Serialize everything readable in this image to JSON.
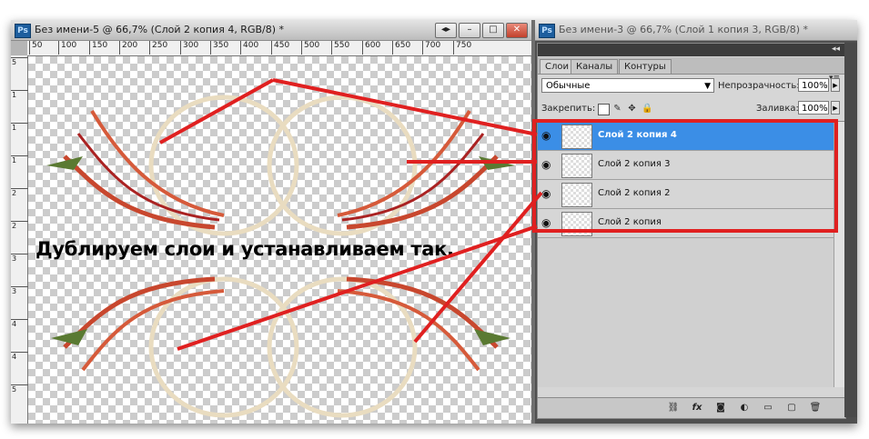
{
  "doc_window": {
    "title": "Без имени-5 @ 66,7% (Слой 2 копия 4, RGB/8) *",
    "app_badge": "Ps",
    "buttons": {
      "collapse": "◂▸",
      "minimize": "–",
      "maximize": "□",
      "close": "✕"
    },
    "ruler_h": [
      "50",
      "100",
      "150",
      "200",
      "250",
      "300",
      "350",
      "400",
      "450",
      "500",
      "550",
      "600",
      "650",
      "700",
      "750"
    ],
    "ruler_v": [
      "5",
      "1",
      "1",
      "1",
      "2",
      "2",
      "3",
      "3",
      "4",
      "4",
      "5"
    ]
  },
  "overlay_caption": "Дублируем слои и устанавливаем так.",
  "doc_window2": {
    "title": "Без имени-3 @ 66,7% (Слой 1 копия 3, RGB/8) *",
    "app_badge": "Ps"
  },
  "layers_panel": {
    "tabs": [
      "Слои",
      "Каналы",
      "Контуры"
    ],
    "active_tab": "Слои",
    "blend_mode": "Обычные",
    "opacity_label": "Непрозрачность:",
    "opacity_value": "100%",
    "lock_label": "Закрепить:",
    "fill_label": "Заливка:",
    "fill_value": "100%",
    "layers": [
      {
        "name": "Слой 2 копия 4",
        "selected": true
      },
      {
        "name": "Слой 2 копия 3",
        "selected": false
      },
      {
        "name": "Слой 2 копия 2",
        "selected": false
      },
      {
        "name": "Слой 2 копия",
        "selected": false
      }
    ],
    "bottom_icons": [
      "link-icon",
      "fx-icon",
      "mask-icon",
      "adjustment-icon",
      "group-icon",
      "new-layer-icon",
      "trash-icon"
    ],
    "bottom_labels": [
      "⛓",
      "fx",
      "◙",
      "◐",
      "▭",
      "▢",
      "🗑"
    ]
  },
  "colors": {
    "accent_red": "#e02020",
    "selection_blue": "#3b8ee6"
  }
}
